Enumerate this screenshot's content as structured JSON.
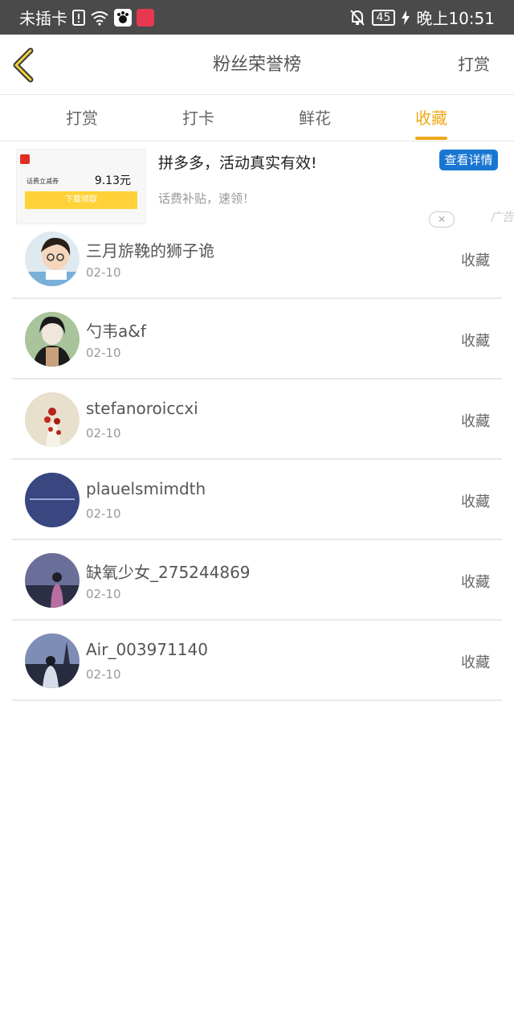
{
  "status_bar": {
    "carrier": "未插卡",
    "battery": "45",
    "time": "晚上10:51"
  },
  "header": {
    "title": "粉丝荣誉榜",
    "action": "打赏"
  },
  "tabs": [
    {
      "label": "打赏",
      "active": false
    },
    {
      "label": "打卡",
      "active": false
    },
    {
      "label": "鲜花",
      "active": false
    },
    {
      "label": "收藏",
      "active": true
    }
  ],
  "ad": {
    "thumb_label": "话费立减券",
    "thumb_price": "9.13元",
    "thumb_button": "下载领取",
    "title": "拼多多，活动真实有效!",
    "subtitle": "话费补贴，速领！",
    "button": "查看详情",
    "mark": "广告",
    "close": "✕"
  },
  "fans": [
    {
      "name": "三月旂鞔的狮子诡",
      "date": "02-10",
      "type": "收藏"
    },
    {
      "name": "勺韦a&f",
      "date": "02-10",
      "type": "收藏"
    },
    {
      "name": "stefanoroiccxi",
      "date": "02-10",
      "type": "收藏"
    },
    {
      "name": "plauelsmimdth",
      "date": "02-10",
      "type": "收藏"
    },
    {
      "name": "缺氧少女_275244869",
      "date": "02-10",
      "type": "收藏"
    },
    {
      "name": "Air_003971140",
      "date": "02-10",
      "type": "收藏"
    }
  ],
  "colors": {
    "accent": "#f0a818",
    "status_bar": "#4a4a4a",
    "ad_button": "#1976d2"
  }
}
